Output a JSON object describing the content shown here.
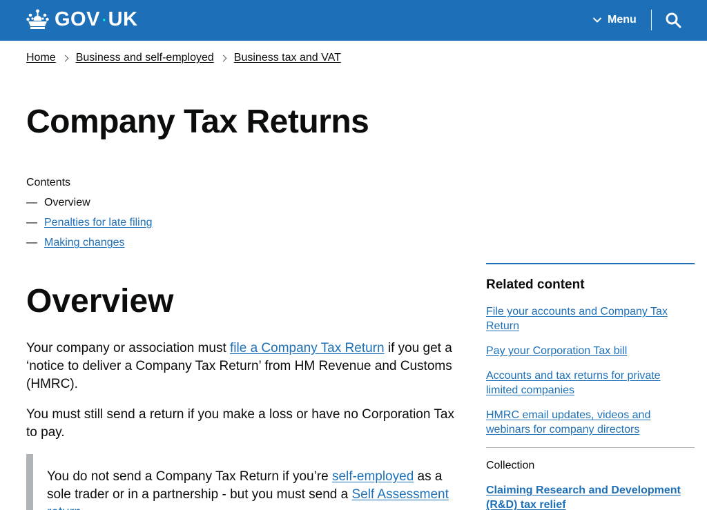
{
  "header": {
    "logo_text_left": "GOV",
    "logo_dot": "·",
    "logo_text_right": "UK",
    "menu_label": "Menu",
    "icons": {
      "logo": "crown-icon",
      "menu": "chevron-down-icon",
      "search": "search-icon"
    }
  },
  "breadcrumb": [
    "Home",
    "Business and self-employed",
    "Business tax and VAT"
  ],
  "page_title": "Company Tax Returns",
  "contents": {
    "label": "Contents",
    "dash": "—",
    "items": [
      {
        "label": "Overview",
        "current": true
      },
      {
        "label": "Penalties for late filing",
        "current": false
      },
      {
        "label": "Making changes",
        "current": false
      }
    ]
  },
  "overview": {
    "title": "Overview",
    "p1_before": "Your company or association must ",
    "p1_link": "file a Company Tax Return",
    "p1_after": " if you get a ‘notice to deliver a Company Tax Return’ from HM Revenue and Customs (HMRC).",
    "p2": "You must still send a return if you make a loss or have no Corporation Tax to pay.",
    "inset_before": "You do not send a Company Tax Return if you’re ",
    "inset_link1": "self-employed",
    "inset_middle": " as a sole trader or in a partnership - but you must send a ",
    "inset_link2": "Self Assessment return",
    "inset_after": "."
  },
  "sidebar": {
    "related_title": "Related content",
    "related_links": [
      "File your accounts and Company Tax Return",
      "Pay your Corporation Tax bill",
      "Accounts and tax returns for private limited companies",
      "HMRC email updates, videos and webinars for company directors"
    ],
    "collection_label": "Collection",
    "collection_link": "Claiming Research and Development (R&D) tax relief"
  },
  "colors": {
    "brand": "#1d70b8",
    "text": "#0b0c0c",
    "border": "#b1b4b6",
    "logo_dot": "#00ffe0"
  }
}
